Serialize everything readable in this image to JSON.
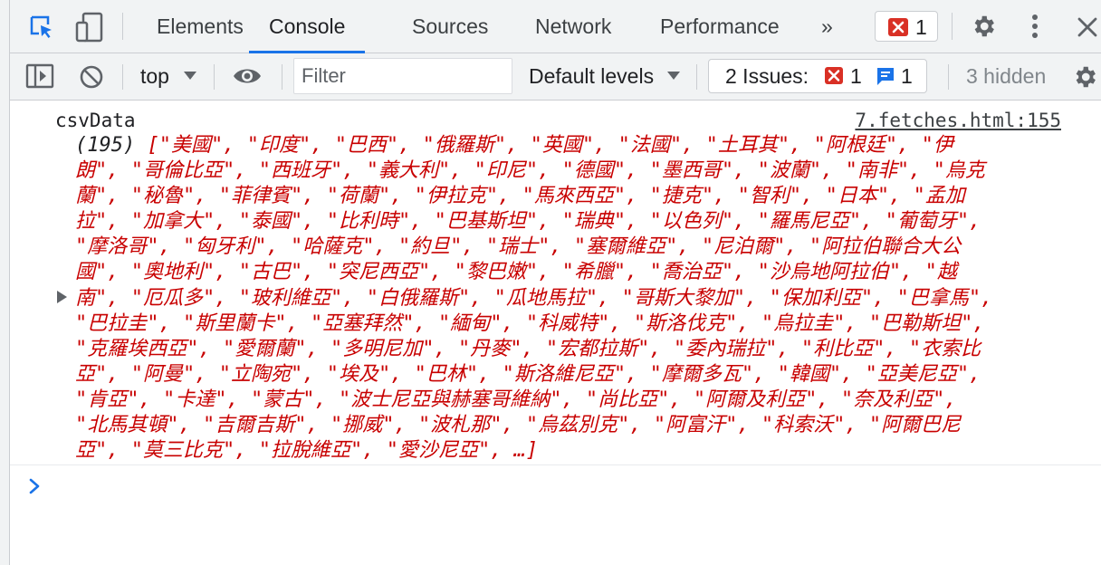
{
  "tabs": {
    "elements": "Elements",
    "console": "Console",
    "sources": "Sources",
    "network": "Network",
    "performance": "Performance",
    "more": "»"
  },
  "errors_count": "1",
  "toolbar": {
    "context": "top",
    "filter_placeholder": "Filter",
    "levels": "Default levels",
    "issues_label": "2 Issues:",
    "issues_errors": "1",
    "issues_messages": "1",
    "hidden": "3 hidden"
  },
  "console": {
    "log_label": "csvData",
    "source": "7.fetches.html:155",
    "array_length": "(195)",
    "array_lines": [
      "[\"美國\", \"印度\", \"巴西\", \"俄羅斯\", \"英國\", \"法國\", \"土耳其\", \"阿根廷\", \"伊",
      "朗\", \"哥倫比亞\", \"西班牙\", \"義大利\", \"印尼\", \"德國\", \"墨西哥\", \"波蘭\", \"南非\", \"烏克",
      "蘭\", \"秘魯\", \"菲律賓\", \"荷蘭\", \"伊拉克\", \"馬來西亞\", \"捷克\", \"智利\", \"日本\", \"孟加",
      "拉\", \"加拿大\", \"泰國\", \"比利時\", \"巴基斯坦\", \"瑞典\", \"以色列\", \"羅馬尼亞\", \"葡萄牙\",",
      "\"摩洛哥\", \"匈牙利\", \"哈薩克\", \"約旦\", \"瑞士\", \"塞爾維亞\", \"尼泊爾\", \"阿拉伯聯合大公",
      "國\", \"奧地利\", \"古巴\", \"突尼西亞\", \"黎巴嫩\", \"希臘\", \"喬治亞\", \"沙烏地阿拉伯\", \"越",
      "南\", \"厄瓜多\", \"玻利維亞\", \"白俄羅斯\", \"瓜地馬拉\", \"哥斯大黎加\", \"保加利亞\", \"巴拿馬\",",
      "\"巴拉圭\", \"斯里蘭卡\", \"亞塞拜然\", \"緬甸\", \"科威特\", \"斯洛伐克\", \"烏拉圭\", \"巴勒斯坦\",",
      "\"克羅埃西亞\", \"愛爾蘭\", \"多明尼加\", \"丹麥\", \"宏都拉斯\", \"委內瑞拉\", \"利比亞\", \"衣索比",
      "亞\", \"阿曼\", \"立陶宛\", \"埃及\", \"巴林\", \"斯洛維尼亞\", \"摩爾多瓦\", \"韓國\", \"亞美尼亞\",",
      "\"肯亞\", \"卡達\", \"蒙古\", \"波士尼亞與赫塞哥維納\", \"尚比亞\", \"阿爾及利亞\", \"奈及利亞\",",
      "\"北馬其頓\", \"吉爾吉斯\", \"挪威\", \"波札那\", \"烏茲別克\", \"阿富汗\", \"科索沃\", \"阿爾巴尼",
      "亞\", \"莫三比克\", \"拉脫維亞\", \"愛沙尼亞\", …]"
    ]
  }
}
